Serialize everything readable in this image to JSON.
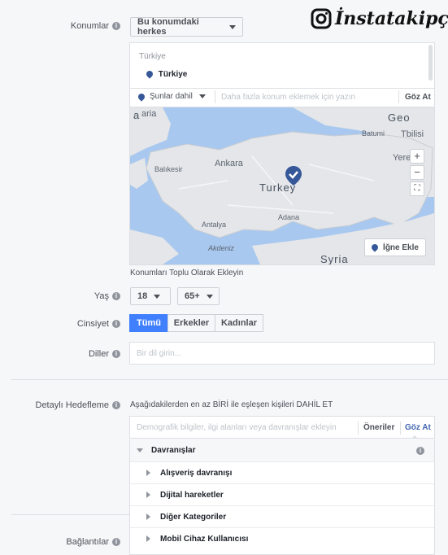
{
  "watermark": {
    "brand": "İnstatakipçi"
  },
  "locations": {
    "label": "Konumlar",
    "audience_dropdown": "Bu konumdaki herkes",
    "country_header": "Türkiye",
    "selected_country": "Türkiye",
    "include_dropdown": "Şunlar dahil",
    "search_placeholder": "Daha fazla konum eklemek için yazın",
    "browse": "Göz At",
    "drop_pin": "İğne Ekle",
    "bulk_link": "Konumları Toplu Olarak Ekleyin",
    "map_labels": {
      "georgia": "Geo",
      "georgia2": "a",
      "tbilisi": "Tbilisi",
      "batumi": "Batumi",
      "yerevan": "Yere",
      "ankara": "Ankara",
      "turkey": "Turkey",
      "balikesir": "Balıkesir",
      "adana": "Adana",
      "antalya": "Antalya",
      "syria": "Syria",
      "akdeniz": "Akdeniz",
      "aria": "aria"
    }
  },
  "age": {
    "label": "Yaş",
    "min": "18",
    "max": "65+",
    "dash": "-"
  },
  "gender": {
    "label": "Cinsiyet",
    "options": [
      "Tümü",
      "Erkekler",
      "Kadınlar"
    ],
    "selected": "Tümü"
  },
  "languages": {
    "label": "Diller",
    "placeholder": "Bir dil girin..."
  },
  "detailed": {
    "label": "Detaylı Hedefleme",
    "description": "Aşağıdakilerden en az BİRİ ile eşleşen kişileri DAHİL ET",
    "search_placeholder": "Demografik bilgiler, ilgi alanları veya davranışlar ekleyin",
    "suggestions": "Öneriler",
    "browse": "Göz At",
    "category": "Davranışlar",
    "items": [
      "Alışveriş davranışı",
      "Dijital hareketler",
      "Diğer Kategoriler",
      "Mobil Cihaz Kullanıcısı"
    ]
  },
  "connections": {
    "label": "Bağlantılar"
  },
  "colors": {
    "primary": "#4080ff",
    "link": "#4267b2",
    "water": "#a8c8ef",
    "land": "#e4e6e9"
  },
  "info_glyph": "i"
}
